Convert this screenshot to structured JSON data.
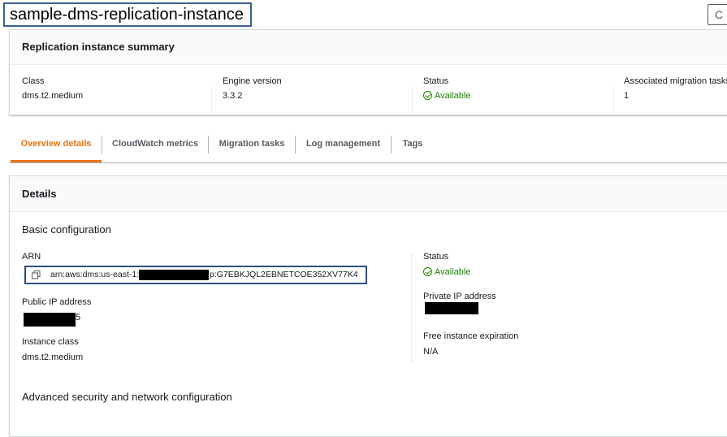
{
  "page": {
    "title": "sample-dms-replication-instance",
    "refresh_glyph": "C"
  },
  "summary": {
    "header": "Replication instance summary",
    "class_label": "Class",
    "class_value": "dms.t2.medium",
    "engine_label": "Engine version",
    "engine_value": "3.3.2",
    "status_label": "Status",
    "status_value": "Available",
    "tasks_label": "Associated migration tasks",
    "tasks_value": "1"
  },
  "tabs": [
    {
      "label": "Overview details"
    },
    {
      "label": "CloudWatch metrics"
    },
    {
      "label": "Migration tasks"
    },
    {
      "label": "Log management"
    },
    {
      "label": "Tags"
    }
  ],
  "details": {
    "header": "Details",
    "basic_title": "Basic configuration",
    "arn_label": "ARN",
    "arn_prefix": "arn:aws:dms:us-east-1:",
    "arn_suffix": "p:G7EBKJQL2EBNETCOE352XV77K4",
    "public_ip_label": "Public IP address",
    "public_ip_tail": "5",
    "instance_class_label": "Instance class",
    "instance_class_value": "dms.t2.medium",
    "status_label": "Status",
    "status_value": "Available",
    "private_ip_label": "Private IP address",
    "free_label": "Free instance expiration",
    "free_value": "N/A",
    "advanced_title": "Advanced security and network configuration"
  },
  "colors": {
    "accent": "#ec7211",
    "success": "#1d8102",
    "highlight_border": "#2f5081"
  },
  "icons": [
    "refresh-icon",
    "status-check-icon",
    "copy-icon"
  ]
}
